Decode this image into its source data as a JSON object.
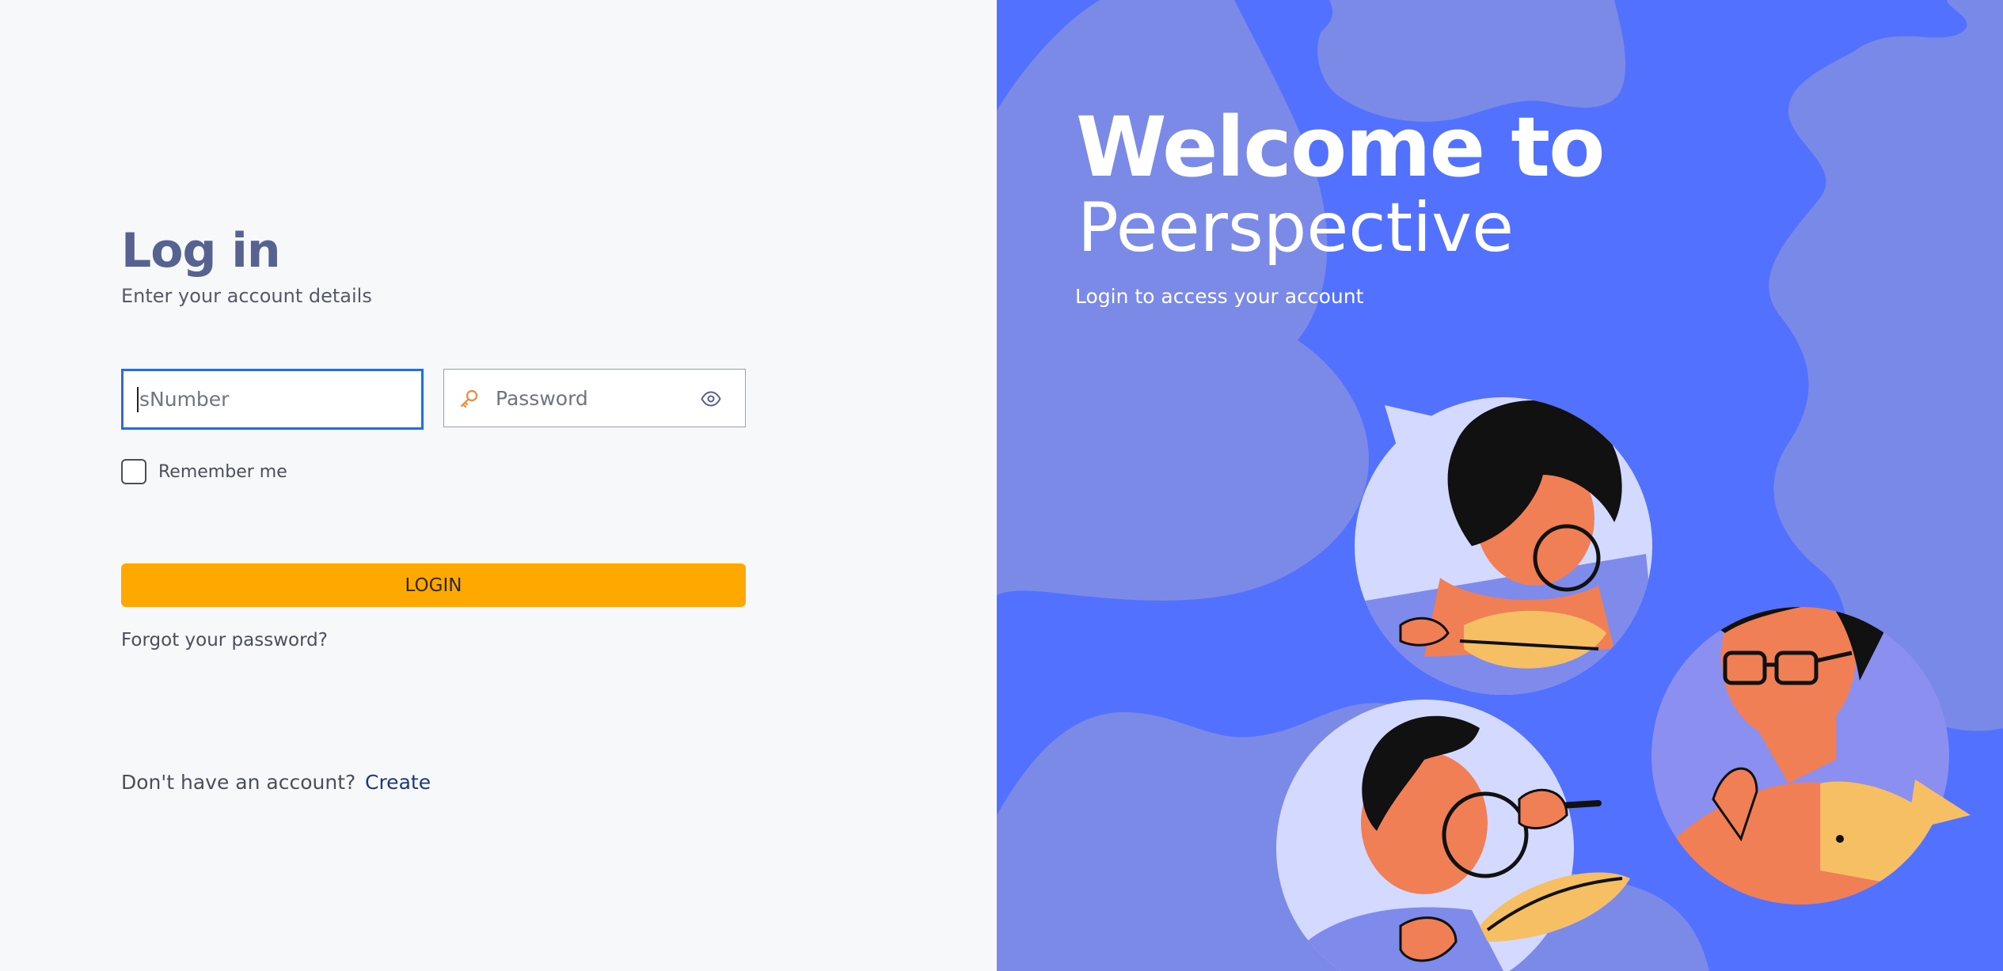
{
  "login": {
    "title": "Log in",
    "subtitle": "Enter your account details",
    "snumber_placeholder": "sNumber",
    "password_placeholder": "Password",
    "remember_label": "Remember me",
    "login_button": "LOGIN",
    "forgot_link": "Forgot your password?",
    "no_account_text": "Don't have an account?",
    "create_link": "Create"
  },
  "welcome": {
    "line1": "Welcome to",
    "line2": "Peerspective",
    "subtitle": "Login to access your account"
  },
  "icons": {
    "password_prefix": "key-icon",
    "password_toggle": "eye-icon"
  },
  "colors": {
    "accent": "#ffa800",
    "brand_blue": "#5271ff",
    "title": "#56628f",
    "focus_border": "#2f6bd6",
    "link": "#1b3a78"
  }
}
